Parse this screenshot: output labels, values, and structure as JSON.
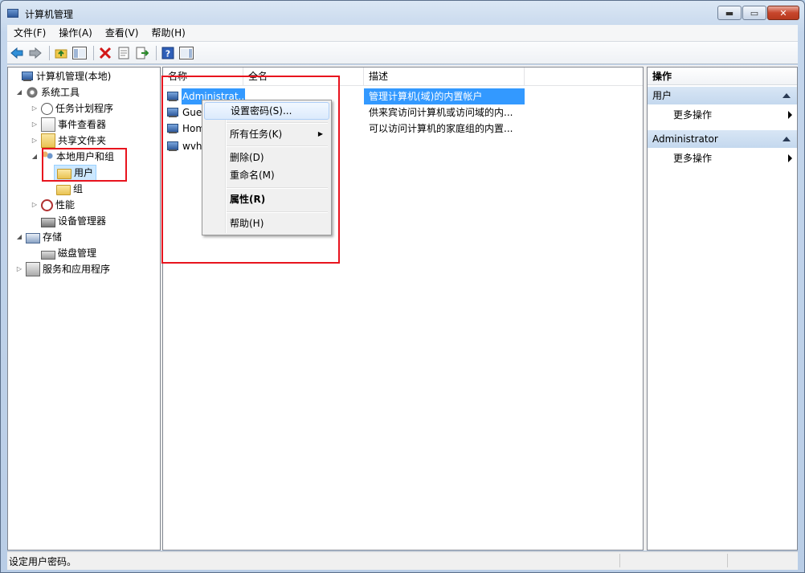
{
  "window": {
    "title": "计算机管理",
    "buttons": {
      "minimize": "▬",
      "maximize": "▭",
      "close": "✕"
    }
  },
  "menu": [
    "文件(F)",
    "操作(A)",
    "查看(V)",
    "帮助(H)"
  ],
  "toolbar": [
    "back-arrow-icon",
    "forward-arrow-icon",
    "up-folder-icon",
    "show-hide-tree-icon",
    "delete-icon",
    "properties-icon",
    "export-list-icon",
    "help-icon",
    "show-hide-action-pane-icon"
  ],
  "tree": [
    {
      "label": "计算机管理(本地)",
      "icon": "computer-management-icon",
      "expander": "",
      "level": 0
    },
    {
      "label": "系统工具",
      "icon": "system-tools-icon",
      "expander": "◢",
      "level": 1
    },
    {
      "label": "任务计划程序",
      "icon": "task-scheduler-icon",
      "expander": "▷",
      "level": 2
    },
    {
      "label": "事件查看器",
      "icon": "event-viewer-icon",
      "expander": "▷",
      "level": 2
    },
    {
      "label": "共享文件夹",
      "icon": "shared-folders-icon",
      "expander": "▷",
      "level": 2
    },
    {
      "label": "本地用户和组",
      "icon": "local-users-groups-icon",
      "expander": "◢",
      "level": 2
    },
    {
      "label": "用户",
      "icon": "users-folder-icon",
      "expander": "",
      "level": 3
    },
    {
      "label": "组",
      "icon": "groups-folder-icon",
      "expander": "",
      "level": 3
    },
    {
      "label": "性能",
      "icon": "performance-icon",
      "expander": "▷",
      "level": 2
    },
    {
      "label": "设备管理器",
      "icon": "device-manager-icon",
      "expander": "",
      "level": 2
    },
    {
      "label": "存储",
      "icon": "storage-icon",
      "expander": "◢",
      "level": 1
    },
    {
      "label": "磁盘管理",
      "icon": "disk-management-icon",
      "expander": "",
      "level": 2
    },
    {
      "label": "服务和应用程序",
      "icon": "services-apps-icon",
      "expander": "▷",
      "level": 1
    }
  ],
  "list": {
    "columns": [
      "名称",
      "全名",
      "描述"
    ],
    "rows": [
      {
        "name": "Administrat...",
        "fullname": "",
        "desc": "管理计算机(域)的内置帐户"
      },
      {
        "name": "Gues",
        "fullname": "",
        "desc": "供来宾访问计算机或访问域的内..."
      },
      {
        "name": "Hom",
        "fullname": "",
        "desc": "可以访问计算机的家庭组的内置..."
      },
      {
        "name": "wvh",
        "fullname": "",
        "desc": ""
      }
    ]
  },
  "context_menu": {
    "set_password": "设置密码(S)...",
    "all_tasks": "所有任务(K)",
    "delete": "删除(D)",
    "rename": "重命名(M)",
    "properties": "属性(R)",
    "help": "帮助(H)"
  },
  "actions": {
    "header": "操作",
    "section1": "用户",
    "more1": "更多操作",
    "section2": "Administrator",
    "more2": "更多操作"
  },
  "status": "设定用户密码。",
  "colors": {
    "selection": "#3399ff",
    "annotation_red": "#e8141e"
  }
}
